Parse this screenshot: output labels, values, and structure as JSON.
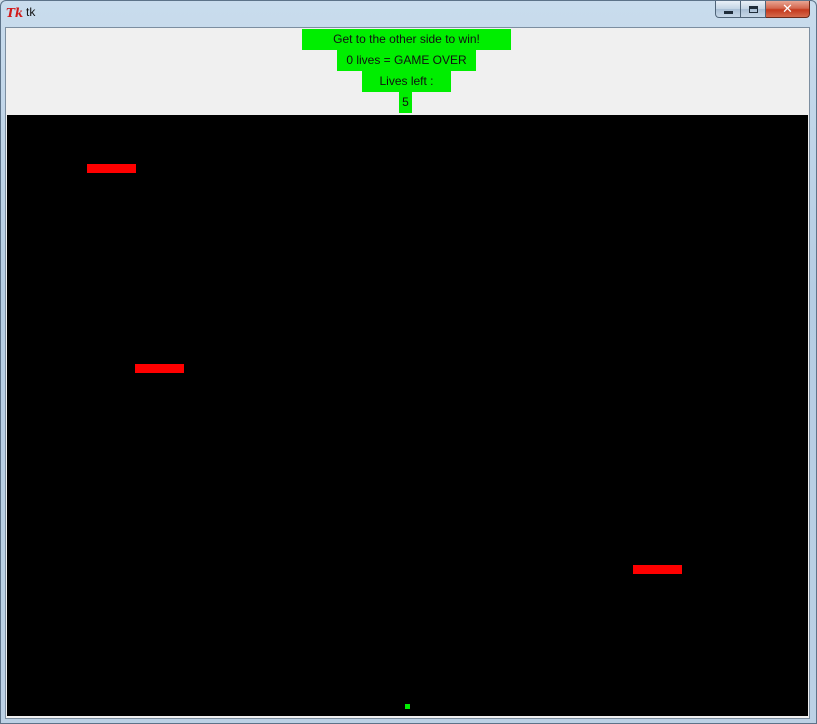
{
  "window": {
    "title": "tk",
    "icon": "tk-feather-icon",
    "icon_text": "Tk",
    "controls": [
      "minimize-icon",
      "maximize-icon",
      "close-icon"
    ],
    "close_glyph": "✕"
  },
  "hud": {
    "goal_text": "Get to the other side to win!",
    "rule_text": "0 lives = GAME OVER",
    "lives_label": "Lives left :",
    "lives_value": "5"
  },
  "colors": {
    "label_bg": "#00ee00",
    "canvas_bg": "#000000",
    "obstacle": "#ff0000",
    "player": "#00ee00"
  },
  "game": {
    "obstacles": [
      {
        "name": "obstacle-1"
      },
      {
        "name": "obstacle-2"
      },
      {
        "name": "obstacle-3"
      }
    ],
    "player": {
      "name": "player"
    }
  }
}
